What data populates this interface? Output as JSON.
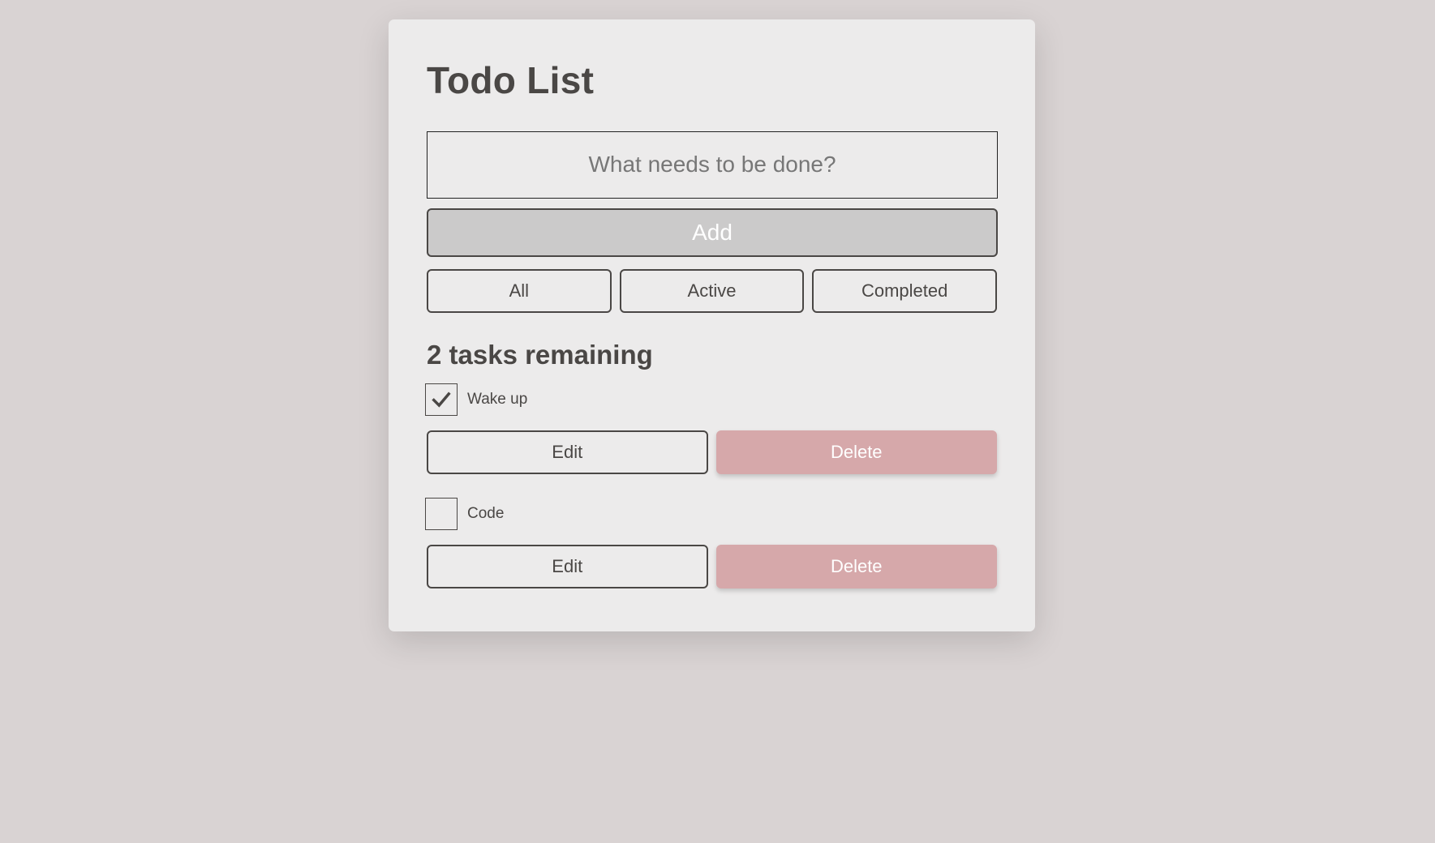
{
  "app": {
    "title": "Todo List"
  },
  "new_todo": {
    "placeholder": "What needs to be done?",
    "value": "",
    "add_label": "Add"
  },
  "filters": [
    {
      "label": "All"
    },
    {
      "label": "Active"
    },
    {
      "label": "Completed"
    }
  ],
  "status": {
    "remaining_text": "2 tasks remaining"
  },
  "todos": [
    {
      "label": "Wake up",
      "completed": true,
      "edit_label": "Edit",
      "delete_label": "Delete"
    },
    {
      "label": "Code",
      "completed": false,
      "edit_label": "Edit",
      "delete_label": "Delete"
    }
  ],
  "colors": {
    "background": "#d9d3d3",
    "card": "#ecebeb",
    "text": "#4a4745",
    "add_button": "#cbcaca",
    "delete_button": "#d6a8aa"
  },
  "icons": {
    "checked": "check-icon"
  }
}
